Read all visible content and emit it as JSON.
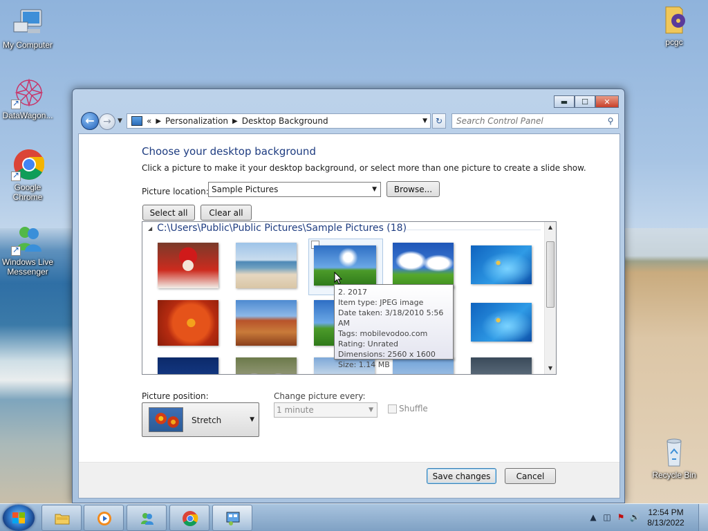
{
  "desktop": {
    "icons": [
      {
        "label": "My Computer"
      },
      {
        "label": "DataWagon..."
      },
      {
        "label": "Google Chrome"
      },
      {
        "label": "Windows Live Messenger"
      },
      {
        "label": "pcgc"
      },
      {
        "label": "Recycle Bin"
      }
    ]
  },
  "window": {
    "controls": {
      "minimize": "▬",
      "maximize": "☐",
      "close": "✕"
    },
    "breadcrumb": {
      "root_arrows": "«",
      "items": [
        "Personalization",
        "Desktop Background"
      ]
    },
    "search": {
      "placeholder": "Search Control Panel"
    }
  },
  "main": {
    "heading": "Choose your desktop background",
    "description": "Click a picture to make it your desktop background, or select more than one picture to create a slide show.",
    "picture_location_label": "Picture location:",
    "picture_location_value": "Sample Pictures",
    "browse_label": "Browse...",
    "select_all_label": "Select all",
    "clear_all_label": "Clear all",
    "gallery": {
      "group_title": "C:\\Users\\Public\\Public Pictures\\Sample Pictures (18)"
    },
    "tooltip": {
      "lines": [
        "2. 2017",
        "Item type: JPEG image",
        "Date taken: 3/18/2010 5:56 AM",
        "Tags: mobilevodoo.com",
        "Rating: Unrated",
        "Dimensions: 2560 x 1600",
        "Size: 1.14 MB"
      ]
    },
    "picture_position_label": "Picture position:",
    "picture_position_value": "Stretch",
    "change_every_label": "Change picture every:",
    "change_every_value": "1 minute",
    "shuffle_label": "Shuffle"
  },
  "footer": {
    "save_label": "Save changes",
    "cancel_label": "Cancel"
  },
  "taskbar": {
    "time": "12:54 PM",
    "date": "8/13/2022"
  }
}
